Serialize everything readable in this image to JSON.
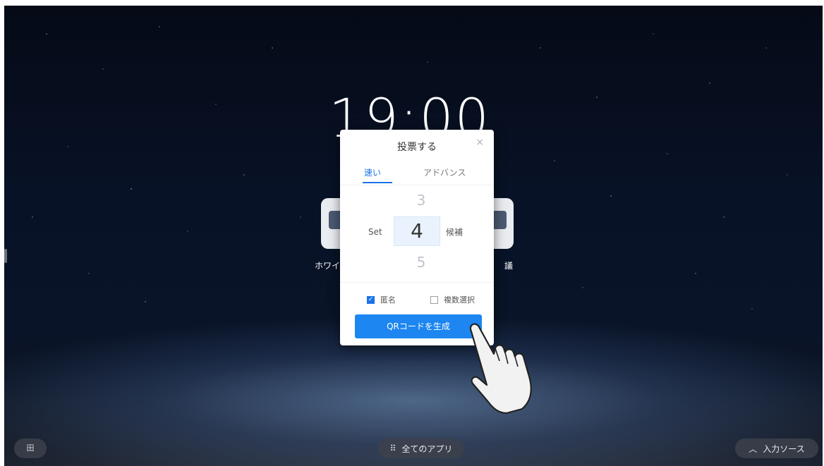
{
  "clock": {
    "time": "19:00"
  },
  "desktop": {
    "app_left_label": "ホワイ",
    "app_right_label": "議"
  },
  "dialog": {
    "title": "投票する",
    "close_icon": "×",
    "tabs": [
      {
        "label": "速い",
        "active": true
      },
      {
        "label": "アドバンス",
        "active": false
      }
    ],
    "picker": {
      "prev_value": "3",
      "value": "4",
      "next_value": "5",
      "left_label": "Set",
      "right_label": "候補"
    },
    "options": [
      {
        "label": "匿名",
        "checked": true
      },
      {
        "label": "複数選択",
        "checked": false
      }
    ],
    "primary_button": "QRコードを生成"
  },
  "taskbar": {
    "left_button_icon": "grid-icon",
    "left_button_text": "田",
    "all_apps_icon": "dots-grid-icon",
    "all_apps_glyph": "⠿",
    "all_apps_label": "全てのアプリ",
    "input_source_icon": "chevron-up-icon",
    "input_source_glyph": "︿",
    "input_source_label": "入力ソース"
  },
  "colors": {
    "accent": "#1d86f0",
    "dialog_bg": "#ffffff",
    "background": "#081226"
  }
}
